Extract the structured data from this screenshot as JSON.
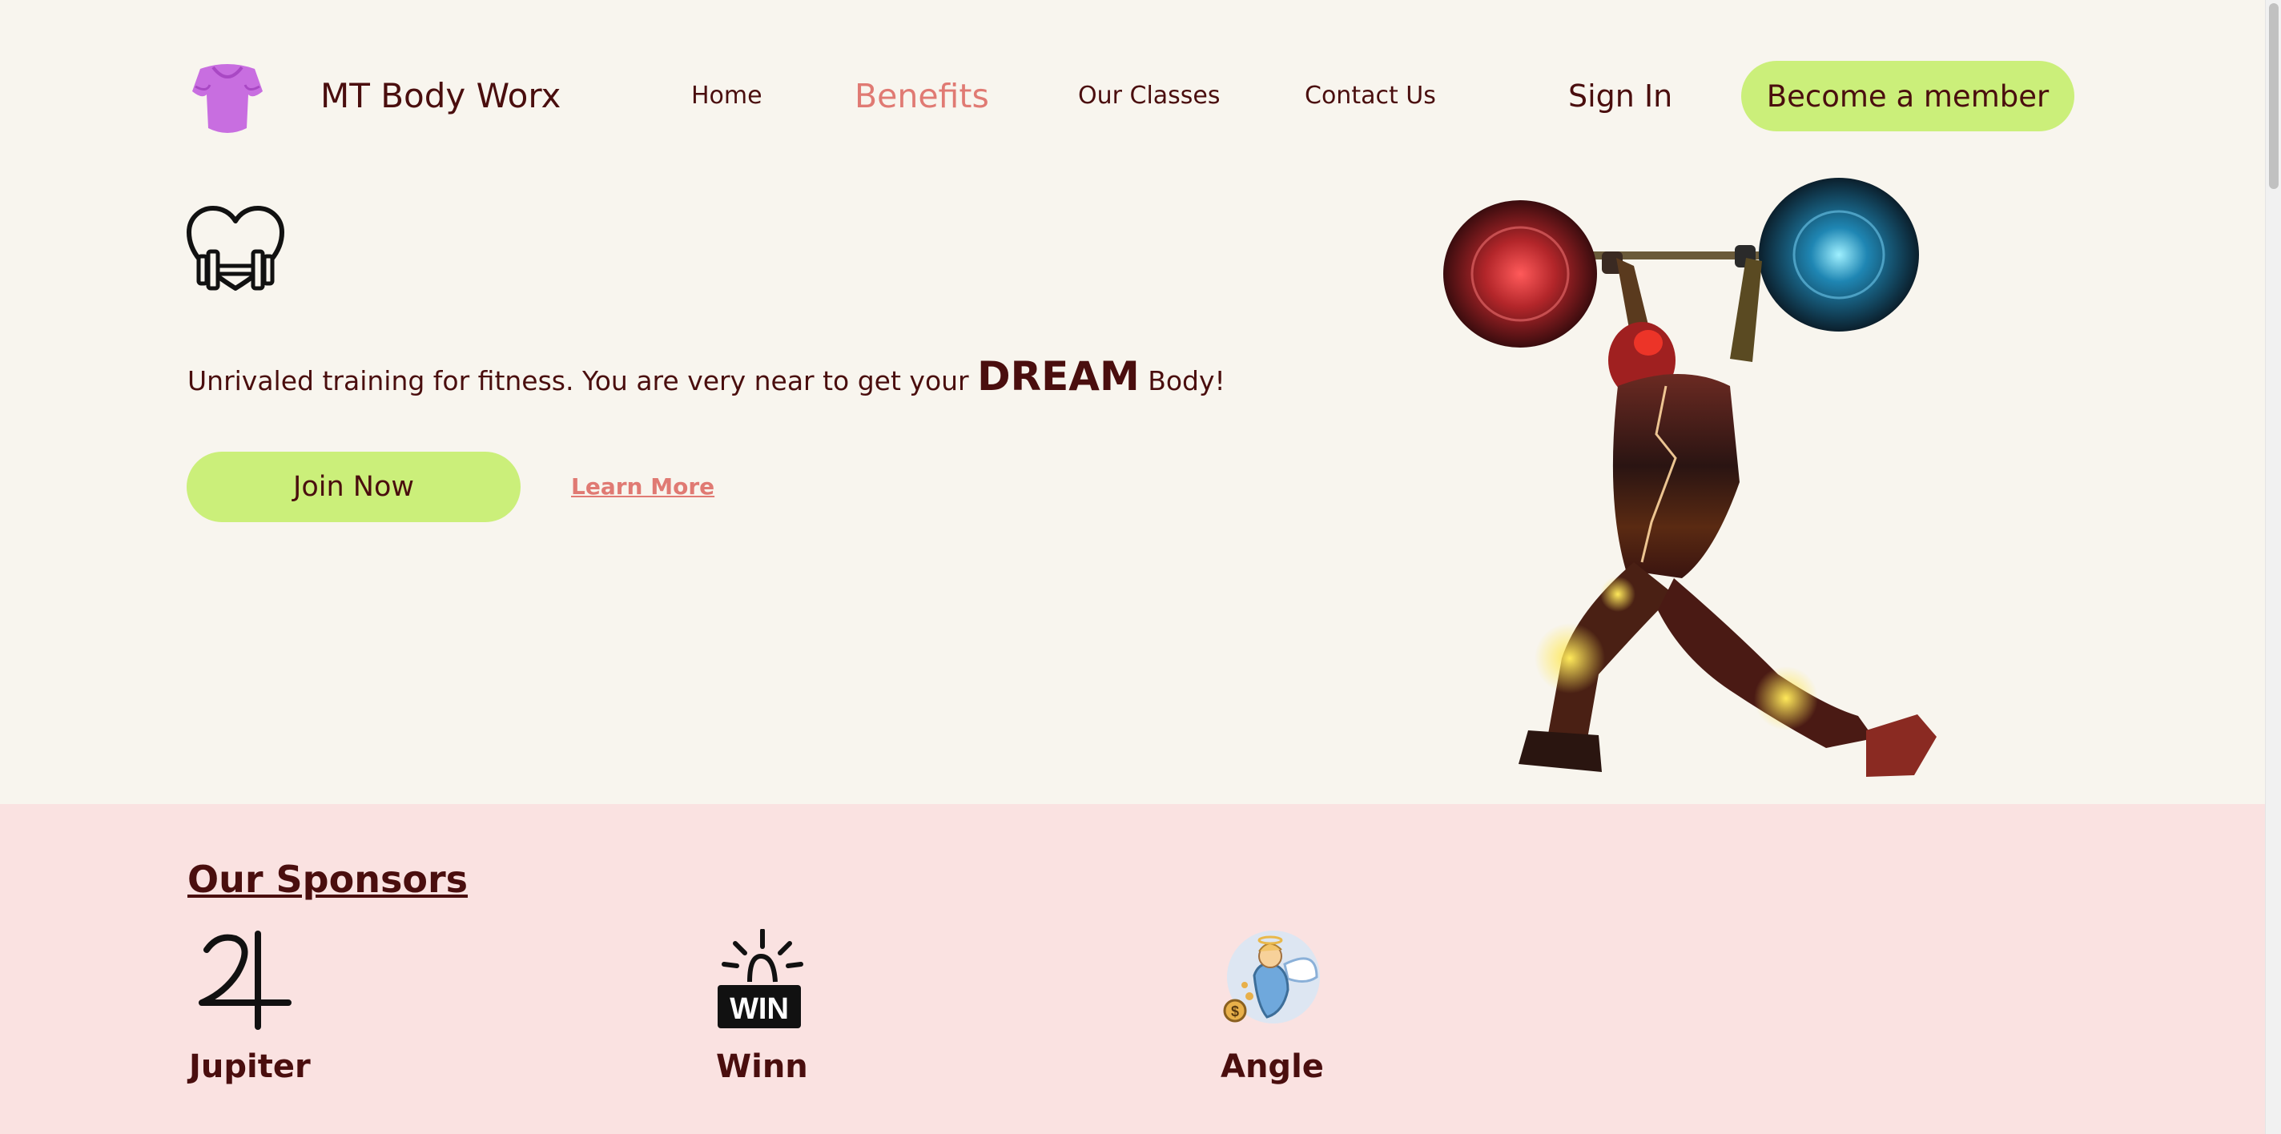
{
  "nav": {
    "brand": "MT Body Worx",
    "logo_icon": "tshirt-icon",
    "links": [
      {
        "label": "Home",
        "active": false
      },
      {
        "label": "Benefits",
        "active": true
      },
      {
        "label": "Our Classes",
        "active": false
      },
      {
        "label": "Contact Us",
        "active": false
      }
    ],
    "sign_in": "Sign In",
    "member_button": "Become a member"
  },
  "hero": {
    "icon": "heart-dumbbell-icon",
    "tagline_before": "Unrivaled training for fitness. You are very near to get your ",
    "tagline_emphasis": "DREAM",
    "tagline_after": " Body!",
    "join_button": "Join Now",
    "learn_more": "Learn More",
    "image": "weightlifter-illustration"
  },
  "sponsors": {
    "title": "Our Sponsors",
    "items": [
      {
        "name": "Jupiter",
        "icon": "jupiter-symbol-icon"
      },
      {
        "name": "Winn",
        "icon": "win-alarm-icon"
      },
      {
        "name": "Angle",
        "icon": "angel-money-icon"
      }
    ]
  },
  "colors": {
    "background": "#f8f5ee",
    "sponsors_background": "#fae2e1",
    "accent_green": "#cbef7a",
    "text_maroon": "#4a0e0e",
    "link_coral": "#e07a73",
    "logo_purple": "#c86ee0"
  }
}
